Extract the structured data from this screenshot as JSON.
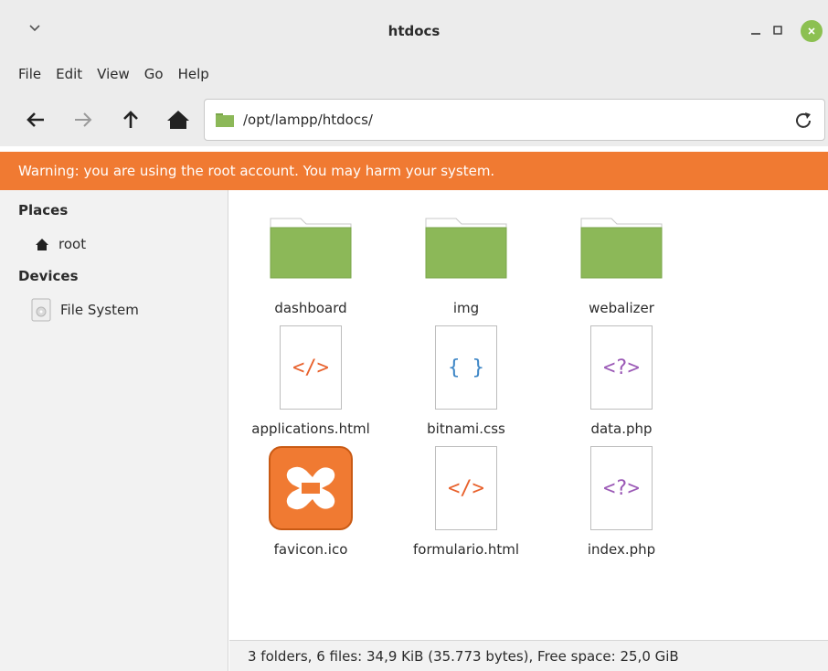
{
  "window": {
    "title": "htdocs"
  },
  "menubar": {
    "items": [
      "File",
      "Edit",
      "View",
      "Go",
      "Help"
    ]
  },
  "toolbar": {
    "path": "/opt/lampp/htdocs/"
  },
  "warning": {
    "text": "Warning: you are using the root account. You may harm your system."
  },
  "sidebar": {
    "places_heading": "Places",
    "places": [
      {
        "label": "root",
        "icon": "home-icon"
      }
    ],
    "devices_heading": "Devices",
    "devices": [
      {
        "label": "File System",
        "icon": "drive-icon"
      }
    ]
  },
  "files": [
    {
      "name": "dashboard",
      "type": "folder"
    },
    {
      "name": "img",
      "type": "folder"
    },
    {
      "name": "webalizer",
      "type": "folder"
    },
    {
      "name": "applications.html",
      "type": "html",
      "glyph": "</>"
    },
    {
      "name": "bitnami.css",
      "type": "css",
      "glyph": "{ }"
    },
    {
      "name": "data.php",
      "type": "php",
      "glyph": "<?>"
    },
    {
      "name": "favicon.ico",
      "type": "ico"
    },
    {
      "name": "formulario.html",
      "type": "html",
      "glyph": "</>"
    },
    {
      "name": "index.php",
      "type": "php",
      "glyph": "<?>"
    }
  ],
  "status": {
    "text": "3 folders, 6 files: 34,9 KiB (35.773 bytes), Free space: 25,0 GiB"
  },
  "colors": {
    "folder": "#8cb858",
    "warning": "#f07a32",
    "close": "#8cc051"
  }
}
